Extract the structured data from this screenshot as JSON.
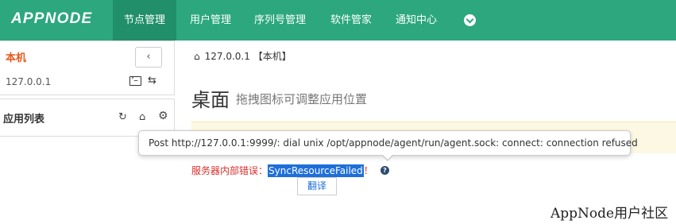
{
  "brand": {
    "logo_text": "APPNODE",
    "accent": "#2ca77e",
    "accent_dark": "#218f6a"
  },
  "nav": {
    "items": [
      {
        "label": "节点管理",
        "active": true
      },
      {
        "label": "用户管理",
        "active": false
      },
      {
        "label": "序列号管理",
        "active": false
      },
      {
        "label": "软件管家",
        "active": false
      },
      {
        "label": "通知中心",
        "active": false
      }
    ],
    "more_icon": "chevron-down-circle-icon"
  },
  "node": {
    "title": "本机",
    "ip": "127.0.0.1",
    "back_icon": "‹",
    "swap_icon": "⇆"
  },
  "apps": {
    "title": "应用列表",
    "sync_icon": "↻",
    "home_icon": "⌂",
    "gear_icon": "⚙"
  },
  "breadcrumb": {
    "home_icon": "⌂",
    "text": "127.0.0.1 【本机】"
  },
  "page": {
    "title": "桌面",
    "subtitle": "拖拽图标可调整应用位置"
  },
  "tooltip": {
    "text": "Post http://127.0.0.1:9999/: dial unix /opt/appnode/agent/run/agent.sock: connect: connection refused"
  },
  "error": {
    "prefix": "服务器内部错误：",
    "code": "SyncResourceFailed",
    "suffix": "！",
    "help_icon": "?",
    "color": "#d9302c"
  },
  "translate_label": "翻译",
  "watermark": "AppNode用户社区"
}
